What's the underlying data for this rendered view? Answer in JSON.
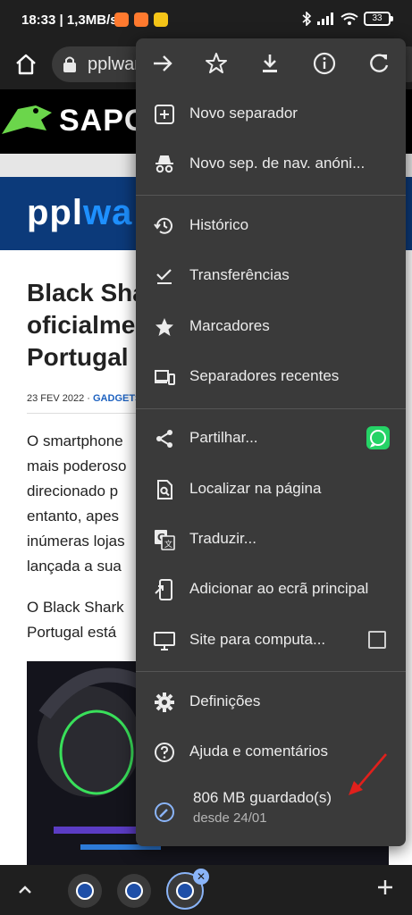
{
  "status_bar": {
    "time": "18:33",
    "speed": "1,3MB/s",
    "battery": "33"
  },
  "toolbar": {
    "url": "pplware"
  },
  "page": {
    "brand": "SAPO",
    "site_logo_a": "ppl",
    "site_logo_b": "wa",
    "headline_lines": [
      "Black Shar",
      "oficialmen",
      "Portugal a"
    ],
    "date": "23 FEV 2022 · ",
    "category": "GADGETS",
    "paragraph1_lines": [
      "O smartphone",
      "mais poderoso",
      "direcionado p",
      "entanto, apes",
      "inúmeras lojas",
      "lançada a sua"
    ],
    "paragraph2_lines": [
      "O Black Shark",
      "Portugal está"
    ]
  },
  "menu": {
    "top_icons": [
      "forward-icon",
      "star-icon",
      "download-icon",
      "info-icon",
      "refresh-icon"
    ],
    "new_tab": "Novo separador",
    "incognito": "Novo sep. de nav. anóni...",
    "history": "Histórico",
    "downloads": "Transferências",
    "bookmarks": "Marcadores",
    "recent_tabs": "Separadores recentes",
    "share": "Partilhar...",
    "find": "Localizar na página",
    "translate": "Traduzir...",
    "add_home": "Adicionar ao ecrã principal",
    "desktop_site": "Site para computa...",
    "settings": "Definições",
    "help": "Ajuda e comentários",
    "data_saver": "806 MB guardado(s)",
    "data_saver_since": "desde 24/01"
  },
  "colors": {
    "menu_bg": "#3a3a3a",
    "chrome_bg": "#1f1f1f",
    "accent": "#8ab4f8",
    "whatsapp": "#25d366",
    "annotation_arrow": "#e0201c"
  }
}
